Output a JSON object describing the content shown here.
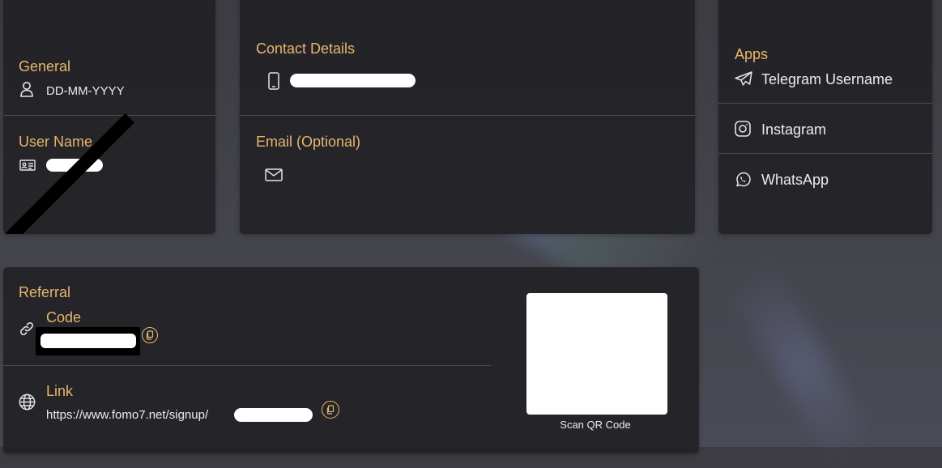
{
  "general": {
    "heading": "General",
    "dob": "DD-MM-YYYY"
  },
  "username": {
    "heading": "User Name"
  },
  "contact": {
    "heading": "Contact Details",
    "email_heading": "Email (Optional)"
  },
  "apps": {
    "heading": "Apps",
    "items": [
      {
        "label": "Telegram Username",
        "icon": "telegram-icon"
      },
      {
        "label": "Instagram",
        "icon": "instagram-icon"
      },
      {
        "label": "WhatsApp",
        "icon": "whatsapp-icon"
      }
    ]
  },
  "referral": {
    "heading": "Referral",
    "code_label": "Code",
    "link_label": "Link",
    "link_prefix": "https://www.fomo7.net/signup/",
    "qr_caption": "Scan QR Code"
  },
  "colors": {
    "accent": "#e8b66c",
    "card": "#232328",
    "divider": "#4b4b52"
  }
}
